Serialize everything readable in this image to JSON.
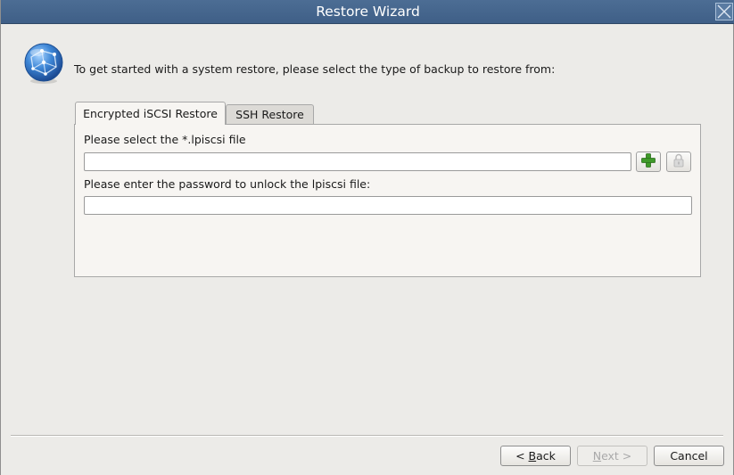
{
  "window": {
    "title": "Restore Wizard"
  },
  "intro_text": "To get started with a system restore, please select the type of backup to restore from:",
  "tabs": [
    {
      "label": "Encrypted iSCSI Restore",
      "active": true
    },
    {
      "label": "SSH Restore",
      "active": false
    }
  ],
  "form": {
    "file_label": "Please select the *.lpiscsi file",
    "file_value": "",
    "password_label": "Please enter the password to unlock the lpiscsi file:",
    "password_value": ""
  },
  "icons": {
    "add": "plus-icon",
    "lock": "lock-icon",
    "globe": "globe-icon",
    "close": "close-icon"
  },
  "buttons": {
    "back_prefix": "< ",
    "back_mnemonic": "B",
    "back_rest": "ack",
    "next_prefix": "",
    "next_mnemonic": "N",
    "next_rest": "ext >",
    "cancel": "Cancel"
  },
  "colors": {
    "titlebar": "#4c6d94",
    "window_bg": "#ecebe8",
    "add_icon": "#3f9a2a"
  }
}
